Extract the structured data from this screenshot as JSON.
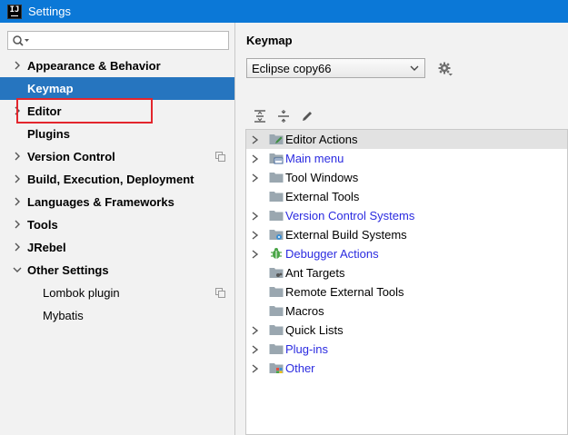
{
  "window": {
    "title": "Settings",
    "app_icon_text": "IJ"
  },
  "search": {
    "value": "",
    "placeholder": ""
  },
  "sidebar": {
    "items": [
      {
        "label": "Appearance & Behavior",
        "expandable": true
      },
      {
        "label": "Keymap",
        "expandable": false,
        "selected": true
      },
      {
        "label": "Editor",
        "expandable": true
      },
      {
        "label": "Plugins",
        "expandable": false
      },
      {
        "label": "Version Control",
        "expandable": true,
        "copy_icon": true
      },
      {
        "label": "Build, Execution, Deployment",
        "expandable": true
      },
      {
        "label": "Languages & Frameworks",
        "expandable": true
      },
      {
        "label": "Tools",
        "expandable": true
      },
      {
        "label": "JRebel",
        "expandable": true
      },
      {
        "label": "Other Settings",
        "expandable": true,
        "expanded": true
      },
      {
        "label": "Lombok plugin",
        "child": true,
        "copy_icon": true
      },
      {
        "label": "Mybatis",
        "child": true
      }
    ]
  },
  "keymap": {
    "title": "Keymap",
    "selected_keymap": "Eclipse copy66",
    "toolbar": [
      "expand-all-icon",
      "collapse-all-icon",
      "edit-icon"
    ],
    "actions": [
      {
        "label": "Editor Actions",
        "expandable": true,
        "color": "#000000",
        "icon": "folder-edit-icon"
      },
      {
        "label": "Main menu",
        "expandable": true,
        "color": "#2b2be0",
        "icon": "folder-menu-icon"
      },
      {
        "label": "Tool Windows",
        "expandable": true,
        "color": "#000000",
        "icon": "folder-icon"
      },
      {
        "label": "External Tools",
        "expandable": false,
        "color": "#000000",
        "icon": "folder-icon"
      },
      {
        "label": "Version Control Systems",
        "expandable": true,
        "color": "#2b2be0",
        "icon": "folder-icon"
      },
      {
        "label": "External Build Systems",
        "expandable": true,
        "color": "#000000",
        "icon": "folder-gear-icon"
      },
      {
        "label": "Debugger Actions",
        "expandable": true,
        "color": "#2b2be0",
        "icon": "bug-icon"
      },
      {
        "label": "Ant Targets",
        "expandable": false,
        "color": "#000000",
        "icon": "folder-ant-icon"
      },
      {
        "label": "Remote External Tools",
        "expandable": false,
        "color": "#000000",
        "icon": "folder-icon"
      },
      {
        "label": "Macros",
        "expandable": false,
        "color": "#000000",
        "icon": "folder-icon"
      },
      {
        "label": "Quick Lists",
        "expandable": true,
        "color": "#000000",
        "icon": "folder-icon"
      },
      {
        "label": "Plug-ins",
        "expandable": true,
        "color": "#2b2be0",
        "icon": "folder-icon"
      },
      {
        "label": "Other",
        "expandable": true,
        "color": "#2b2be0",
        "icon": "folder-other-icon"
      }
    ]
  },
  "colors": {
    "titlebar": "#0b78d7",
    "selection": "#2675bf",
    "highlight_box": "#e3262d",
    "link_blue": "#2b2be0"
  }
}
